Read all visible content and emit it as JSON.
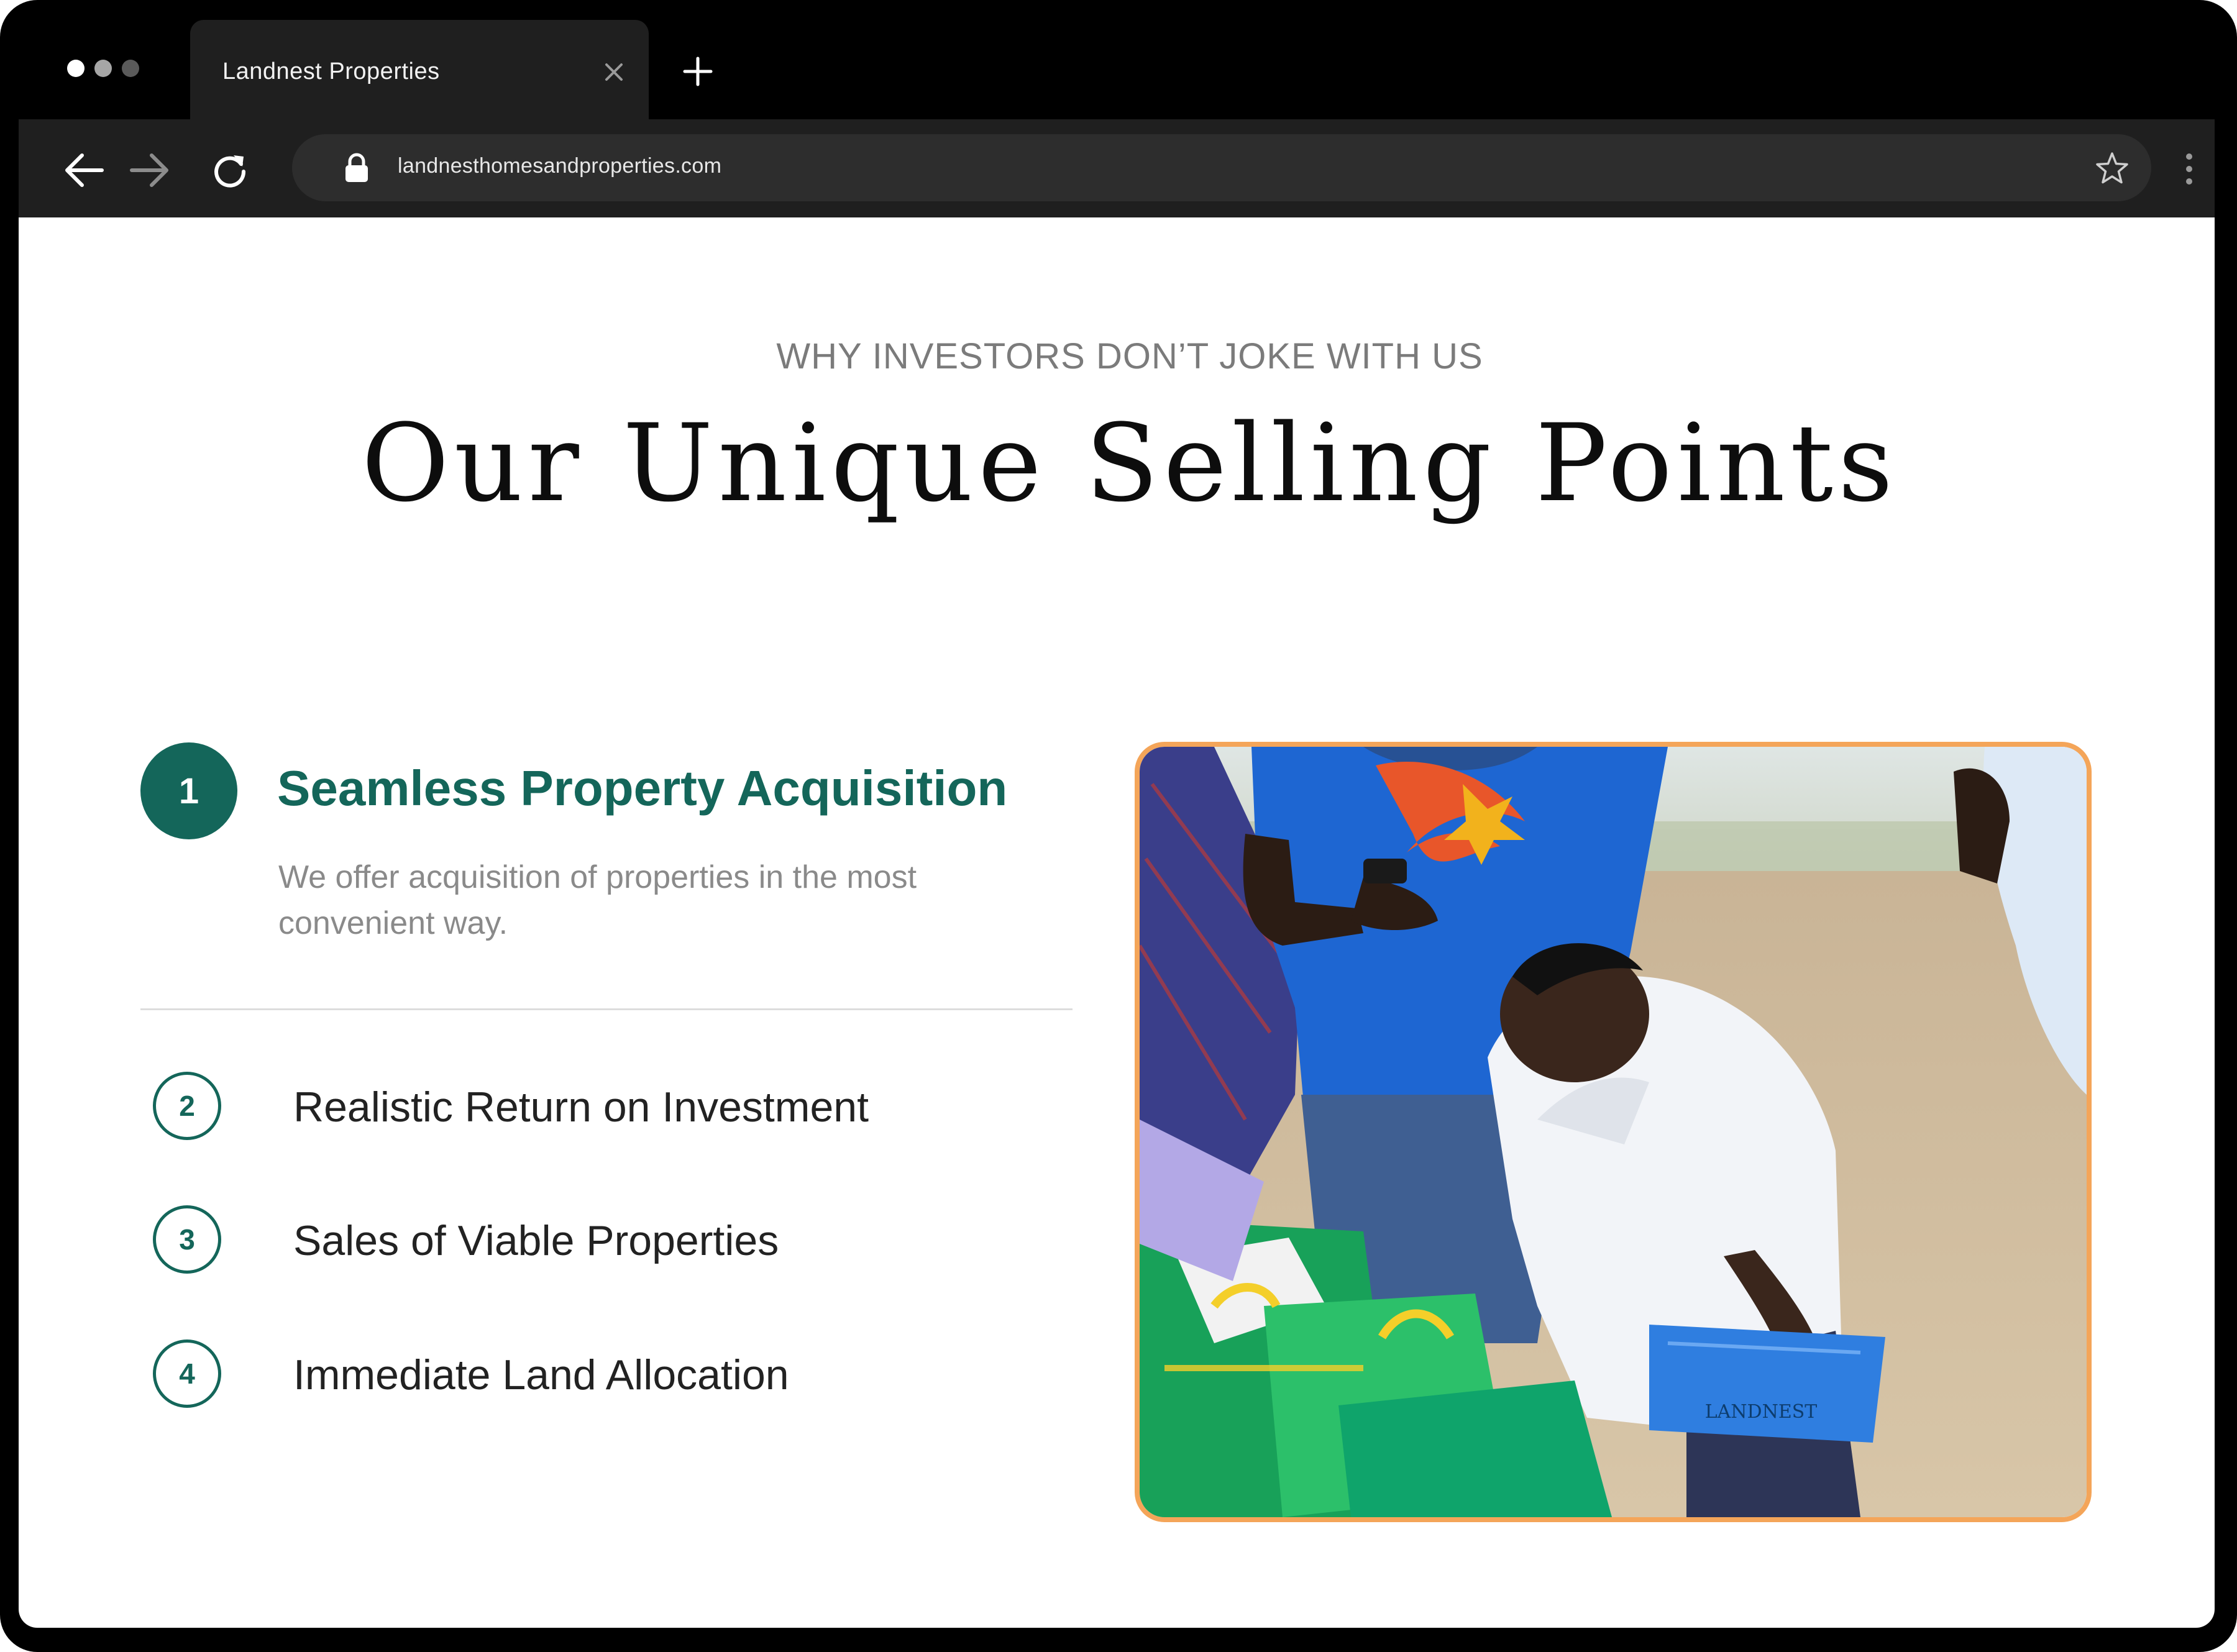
{
  "browser": {
    "tab_title": "Landnest Properties",
    "url": "landnesthomesandproperties.com",
    "traffic_dot_colors": [
      "#ffffff",
      "#a6a6a6",
      "#5a5a5a"
    ]
  },
  "section": {
    "eyebrow": "WHY INVESTORS DON’T JOKE WITH US",
    "title": "Our Unique Selling Points"
  },
  "features": {
    "active": {
      "number": "1",
      "title": "Seamless Property Acquisition",
      "description": "We offer acquisition of properties in the most convenient way."
    },
    "items": [
      {
        "number": "2",
        "label": "Realistic Return on Investment"
      },
      {
        "number": "3",
        "label": "Sales of Viable Properties"
      },
      {
        "number": "4",
        "label": "Immediate Land Allocation"
      }
    ]
  },
  "photo": {
    "watermark": "LANDNEST"
  },
  "colors": {
    "accent": "#14665a",
    "photo_border": "#f4a559",
    "chrome_bg": "#1f1f1f"
  },
  "icons": [
    "back-arrow-icon",
    "forward-arrow-icon",
    "reload-icon",
    "lock-icon",
    "star-icon",
    "kebab-menu-icon",
    "close-icon",
    "plus-icon"
  ]
}
